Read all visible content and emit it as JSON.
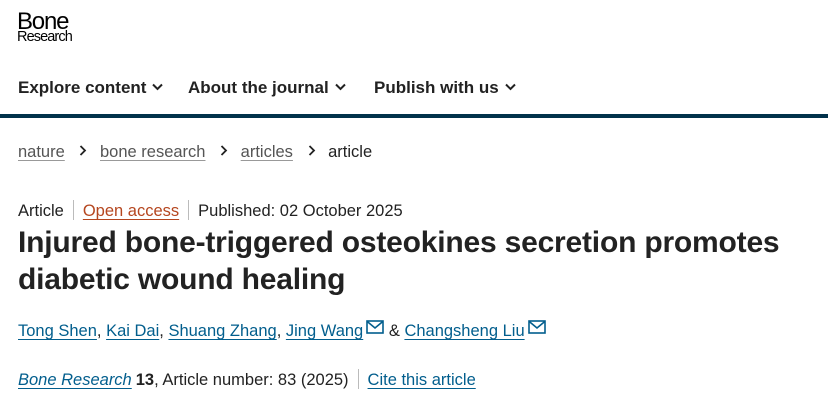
{
  "logo": {
    "line1": "Bone",
    "line2": "Research"
  },
  "nav": {
    "items": [
      {
        "label": "Explore content"
      },
      {
        "label": "About the journal"
      },
      {
        "label": "Publish with us"
      }
    ]
  },
  "breadcrumb": {
    "items": [
      "nature",
      "bone research",
      "articles"
    ],
    "current": "article"
  },
  "meta": {
    "type": "Article",
    "access": "Open access",
    "published": "Published: 02 October 2025"
  },
  "title": "Injured bone-triggered osteokines secretion promotes diabetic wound healing",
  "authors": {
    "list": [
      "Tong Shen",
      "Kai Dai",
      "Shuang Zhang",
      "Jing Wang",
      "Changsheng Liu"
    ],
    "sep": ", ",
    "and": "&"
  },
  "citation": {
    "journal": "Bone Research",
    "volume": "13",
    "rest": ", Article number: 83 (2025)",
    "cite_label": "Cite this article"
  },
  "colors": {
    "brand": "#01324b",
    "link": "#025e8d",
    "open_access": "#b5461f"
  },
  "icons": [
    "chevron-down-icon",
    "chevron-right-icon",
    "mail-icon"
  ]
}
